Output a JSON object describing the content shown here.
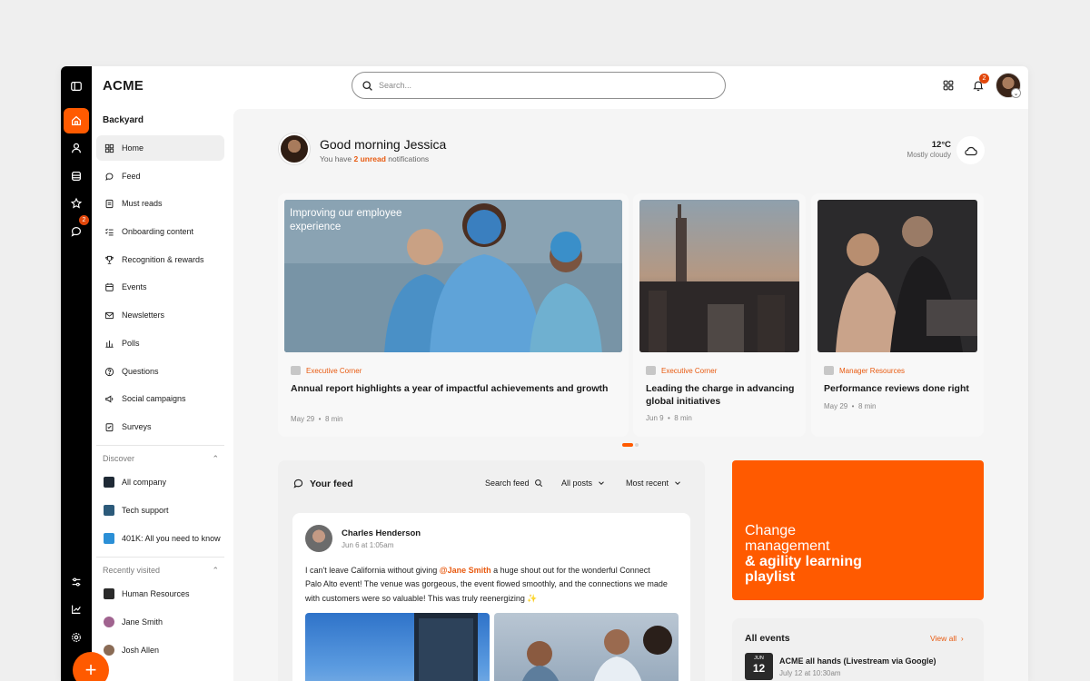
{
  "app": {
    "logo": "ACME"
  },
  "search": {
    "placeholder": "Search..."
  },
  "header": {
    "notification_count": "2"
  },
  "rail": {
    "messages_badge": "2",
    "fab_label": "+"
  },
  "sidebar": {
    "title": "Backyard",
    "items": [
      {
        "label": "Home",
        "icon": "home-grid-icon"
      },
      {
        "label": "Feed",
        "icon": "feed-icon"
      },
      {
        "label": "Must reads",
        "icon": "document-icon"
      },
      {
        "label": "Onboarding content",
        "icon": "checklist-icon"
      },
      {
        "label": "Recognition & rewards",
        "icon": "trophy-icon"
      },
      {
        "label": "Events",
        "icon": "calendar-icon"
      },
      {
        "label": "Newsletters",
        "icon": "mail-icon"
      },
      {
        "label": "Polls",
        "icon": "poll-icon"
      },
      {
        "label": "Questions",
        "icon": "question-icon"
      },
      {
        "label": "Social campaigns",
        "icon": "megaphone-icon"
      },
      {
        "label": "Surveys",
        "icon": "survey-icon"
      }
    ],
    "discover_label": "Discover",
    "discover": [
      {
        "label": "All company",
        "color": "#1f2a36"
      },
      {
        "label": "Tech support",
        "color": "#2c5a7a"
      },
      {
        "label": "401K: All you need to know",
        "color": "#2b8fd6"
      }
    ],
    "recent_label": "Recently visited",
    "recent": [
      {
        "label": "Human Resources",
        "color": "#2a2a2a"
      },
      {
        "label": "Jane Smith",
        "color": "#a0638f"
      },
      {
        "label": "Josh Allen",
        "color": "#8a6b55"
      }
    ]
  },
  "greeting": {
    "title": "Good morning Jessica",
    "sub_prefix": "You have ",
    "sub_highlight": "2 unread",
    "sub_suffix": " notifications"
  },
  "weather": {
    "temp": "12°C",
    "desc": "Mostly cloudy"
  },
  "cards": [
    {
      "overlay": "Improving our employee experience",
      "category": "Executive Corner",
      "title": "Annual report highlights a year of impactful achievements and growth",
      "date": "May 29",
      "duration": "8 min"
    },
    {
      "category": "Executive Corner",
      "title": "Leading the charge in advancing global initiatives",
      "date": "Jun 9",
      "duration": "8 min"
    },
    {
      "category": "Manager Resources",
      "title": "Performance reviews done right",
      "date": "May 29",
      "duration": "8 min"
    }
  ],
  "carousel": {
    "pages": 2,
    "active_page": 1
  },
  "feed": {
    "title": "Your feed",
    "search_label": "Search feed",
    "filter_label": "All posts",
    "sort_label": "Most recent",
    "post": {
      "author": "Charles Henderson",
      "date": "Jun 6 at 1:05am",
      "text_before": "I can't leave California without giving ",
      "mention": "@Jane Smith",
      "text_after": " a huge shout out for the wonderful Connect Palo Alto event! The venue was gorgeous, the event flowed smoothly, and the connections we made with customers were so valuable! This was truly reenergizing ✨"
    }
  },
  "promo": {
    "line1": "Change management",
    "line2": "& agility learning playlist",
    "color": "#ff5a00"
  },
  "events": {
    "title": "All events",
    "view_all": "View all",
    "item": {
      "month": "JUN",
      "day": "12",
      "name": "ACME all hands (Livestream via Google)",
      "date": "July 12 at 10:30am"
    }
  }
}
